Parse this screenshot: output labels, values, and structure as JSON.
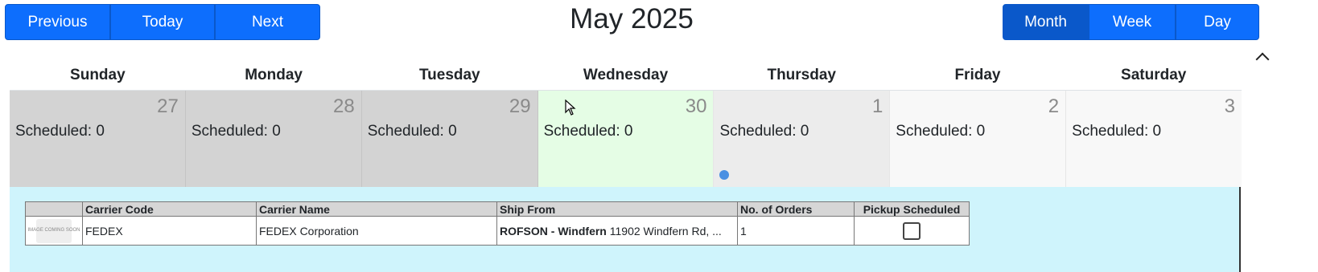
{
  "nav": {
    "previous": "Previous",
    "today": "Today",
    "next": "Next"
  },
  "title": "May 2025",
  "views": {
    "month": "Month",
    "week": "Week",
    "day": "Day",
    "active": "Month"
  },
  "weekdays": [
    "Sunday",
    "Monday",
    "Tuesday",
    "Wednesday",
    "Thursday",
    "Friday",
    "Saturday"
  ],
  "days": [
    {
      "num": "27",
      "scheduled": "Scheduled: 0",
      "state": "past"
    },
    {
      "num": "28",
      "scheduled": "Scheduled: 0",
      "state": "past"
    },
    {
      "num": "29",
      "scheduled": "Scheduled: 0",
      "state": "past"
    },
    {
      "num": "30",
      "scheduled": "Scheduled: 0",
      "state": "today"
    },
    {
      "num": "1",
      "scheduled": "Scheduled: 0",
      "state": "selected",
      "has_event_dot": true
    },
    {
      "num": "2",
      "scheduled": "Scheduled: 0",
      "state": "future"
    },
    {
      "num": "3",
      "scheduled": "Scheduled: 0",
      "state": "future"
    }
  ],
  "carrier_table": {
    "headers": [
      "",
      "Carrier Code",
      "Carrier Name",
      "Ship From",
      "No. of Orders",
      "Pickup Scheduled"
    ],
    "rows": [
      {
        "image_text": "IMAGE COMING SOON",
        "carrier_code": "FEDEX",
        "carrier_name": "FEDEX Corporation",
        "ship_from_name": "ROFSON - Windfern",
        "ship_from_address": "11902 Windfern Rd, ...",
        "orders": "1",
        "pickup_scheduled": false
      }
    ]
  },
  "colors": {
    "primary": "#0d6efd",
    "primary_active": "#0a58ca",
    "past_day": "#d3d3d3",
    "today_day": "#e5fde5",
    "selected_day": "#ececec",
    "detail_panel": "#cff4fc",
    "event_dot": "#4a90e2"
  }
}
